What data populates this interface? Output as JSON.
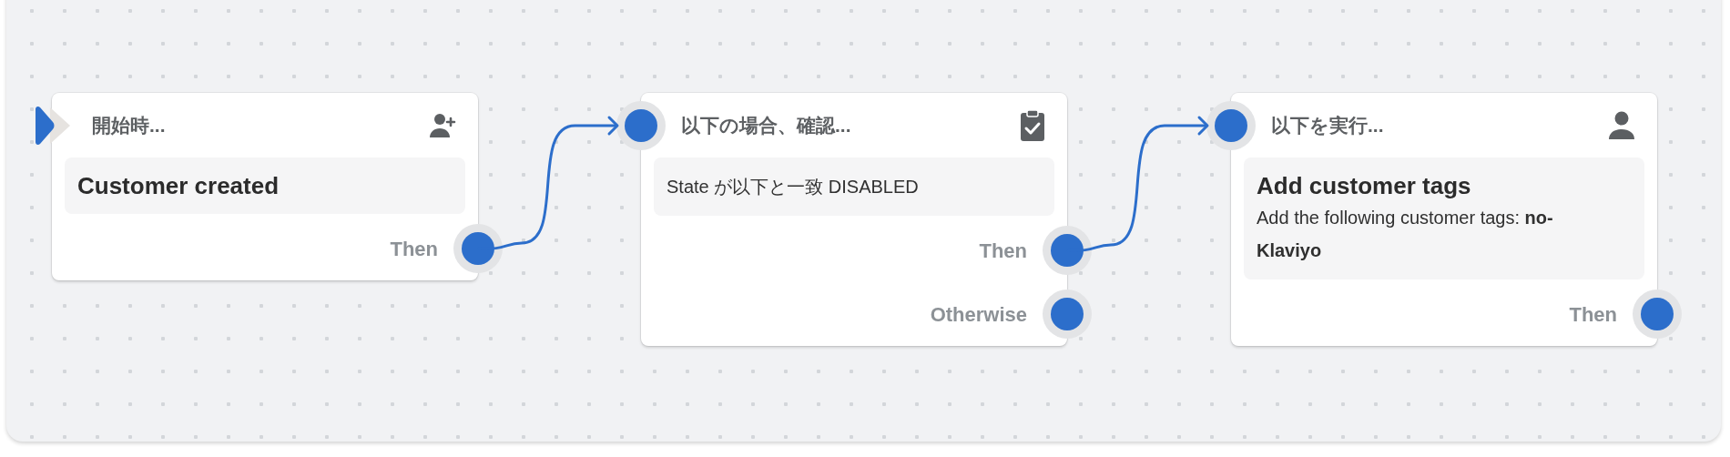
{
  "nodes": [
    {
      "kind": "trigger",
      "title": "開始時...",
      "content": {
        "heading": "Customer created"
      },
      "outputs": [
        {
          "label": "Then"
        }
      ]
    },
    {
      "kind": "condition",
      "title": "以下の場合、確認...",
      "content": {
        "text": "State が以下と一致 DISABLED"
      },
      "outputs": [
        {
          "label": "Then"
        },
        {
          "label": "Otherwise"
        }
      ]
    },
    {
      "kind": "action",
      "title": "以下を実行...",
      "content": {
        "heading": "Add customer tags",
        "text": "Add the following customer tags: **no-Klaviyo**"
      },
      "outputs": [
        {
          "label": "Then"
        }
      ]
    }
  ]
}
